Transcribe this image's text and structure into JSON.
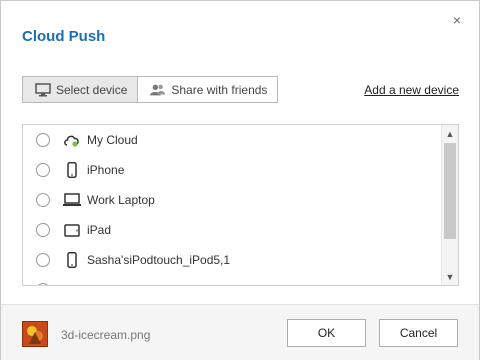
{
  "dialog": {
    "title": "Cloud Push",
    "close_glyph": "×"
  },
  "tabs": [
    {
      "label": "Select device",
      "icon": "monitor-icon",
      "active": true
    },
    {
      "label": "Share with friends",
      "icon": "users-icon",
      "active": false
    }
  ],
  "add_device_link": "Add a new device",
  "devices": [
    {
      "label": "My Cloud",
      "icon": "cloud-icon",
      "status_color": "#7ac143"
    },
    {
      "label": "iPhone",
      "icon": "phone-icon"
    },
    {
      "label": "Work Laptop",
      "icon": "laptop-icon"
    },
    {
      "label": "iPad",
      "icon": "tablet-icon"
    },
    {
      "label": "Sasha'siPodtouch_iPod5,1",
      "icon": "ipod-icon"
    }
  ],
  "scrollbar": {
    "up_glyph": "▲",
    "down_glyph": "▼"
  },
  "footer": {
    "file_name": "3d-icecream.png",
    "ok_label": "OK",
    "cancel_label": "Cancel"
  },
  "colors": {
    "accent": "#1d6fb4"
  }
}
